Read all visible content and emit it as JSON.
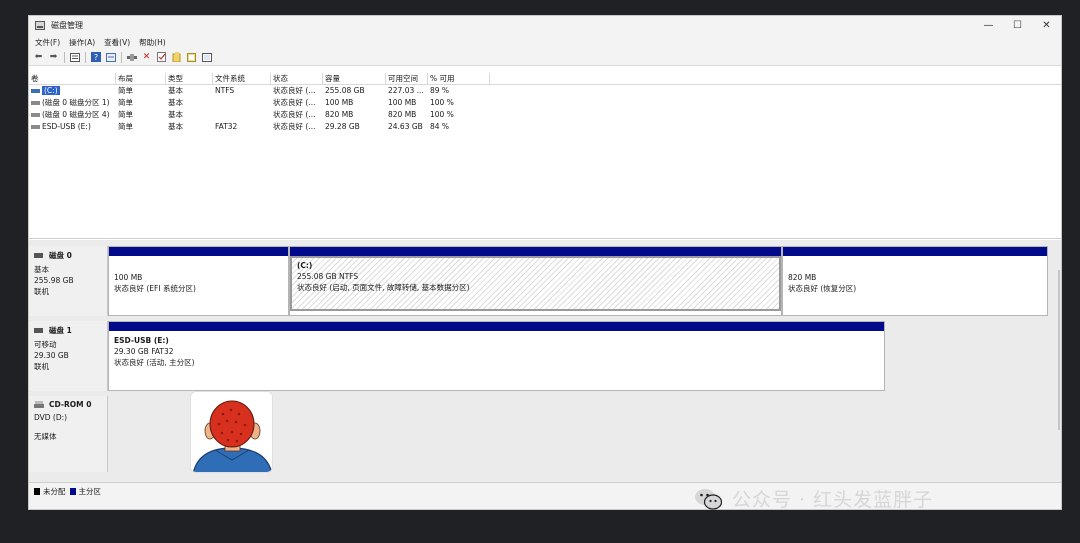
{
  "window": {
    "title": "磁盘管理"
  },
  "window_controls": {
    "minimize": "—",
    "maximize": "☐",
    "close": "✕"
  },
  "menu": [
    "文件(F)",
    "操作(A)",
    "查看(V)",
    "帮助(H)"
  ],
  "toolbar_icons": [
    "back-icon",
    "forward-icon",
    "list-view-icon",
    "help-icon",
    "properties-icon",
    "connect-icon",
    "delete-icon",
    "check-icon",
    "folder-icon",
    "open-icon",
    "view-icon"
  ],
  "volume_list": {
    "columns": [
      "卷",
      "布局",
      "类型",
      "文件系统",
      "状态",
      "容量",
      "可用空间",
      "% 可用"
    ],
    "rows": [
      {
        "vol": "(C:)",
        "layout": "简单",
        "type": "基本",
        "fs": "NTFS",
        "status": "状态良好 (...",
        "capacity": "255.08 GB",
        "free": "227.03 ...",
        "pct": "89 %"
      },
      {
        "vol": "(磁盘 0 磁盘分区 1)",
        "layout": "简单",
        "type": "基本",
        "fs": "",
        "status": "状态良好 (...",
        "capacity": "100 MB",
        "free": "100 MB",
        "pct": "100 %"
      },
      {
        "vol": "(磁盘 0 磁盘分区 4)",
        "layout": "简单",
        "type": "基本",
        "fs": "",
        "status": "状态良好 (...",
        "capacity": "820 MB",
        "free": "820 MB",
        "pct": "100 %"
      },
      {
        "vol": "ESD-USB (E:)",
        "layout": "简单",
        "type": "基本",
        "fs": "FAT32",
        "status": "状态良好 (...",
        "capacity": "29.28 GB",
        "free": "24.63 GB",
        "pct": "84 %"
      }
    ]
  },
  "disks": [
    {
      "name": "磁盘 0",
      "kind": "基本",
      "size": "255.98 GB",
      "state": "联机",
      "partitions": [
        {
          "title": "",
          "size": "100 MB",
          "status": "状态良好 (EFI 系统分区)"
        },
        {
          "title": "(C:)",
          "size": "255.08 GB NTFS",
          "status": "状态良好 (启动, 页面文件, 故障转储, 基本数据分区)"
        },
        {
          "title": "",
          "size": "820 MB",
          "status": "状态良好 (恢复分区)"
        }
      ]
    },
    {
      "name": "磁盘 1",
      "kind": "可移动",
      "size": "29.30 GB",
      "state": "联机",
      "partitions": [
        {
          "title": "ESD-USB  (E:)",
          "size": "29.30 GB FAT32",
          "status": "状态良好 (活动, 主分区)"
        }
      ]
    },
    {
      "name": "CD-ROM 0",
      "kind": "DVD (D:)",
      "size": "",
      "state": "无媒体",
      "partitions": []
    }
  ],
  "legend": [
    {
      "label": "未分配",
      "color": "#000000"
    },
    {
      "label": "主分区",
      "color": "#000a8a"
    }
  ],
  "watermark": {
    "text": "公众号 · 红头发蓝胖子"
  }
}
